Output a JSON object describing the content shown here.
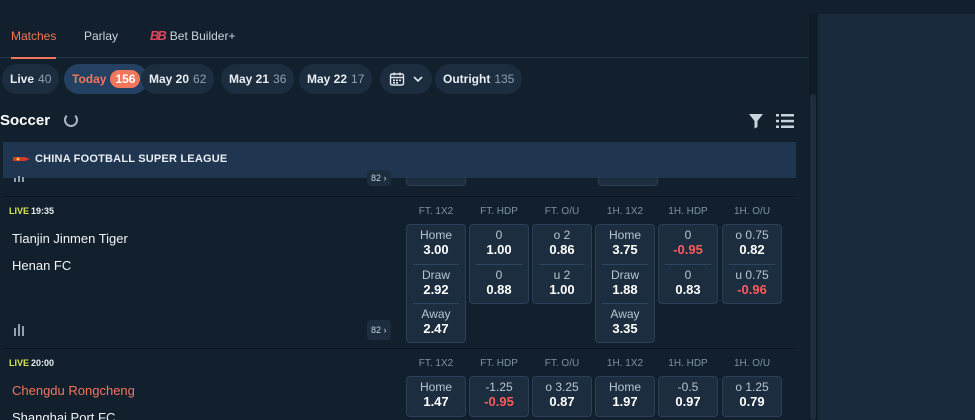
{
  "tabs": [
    {
      "label": "Matches",
      "active": true
    },
    {
      "label": "Parlay",
      "active": false
    },
    {
      "label": "Bet Builder+",
      "active": false
    }
  ],
  "date_filters": [
    {
      "label": "Live",
      "count": "40",
      "active": false
    },
    {
      "label": "Today",
      "count": "156",
      "active": true
    },
    {
      "label": "May 20",
      "count": "62",
      "active": false
    },
    {
      "label": "May 21",
      "count": "36",
      "active": false
    },
    {
      "label": "May 22",
      "count": "17",
      "active": false
    },
    {
      "label": "Outright",
      "count": "135",
      "active": false
    }
  ],
  "sport_title": "Soccer",
  "league_name": "CHINA FOOTBALL SUPER LEAGUE",
  "prev_more_count": "82",
  "matches": [
    {
      "live": "LIVE",
      "time": "19:35",
      "home": "Tianjin Jinmen Tiger",
      "away": "Henan FC",
      "more_count": "82",
      "headers": [
        "FT. 1X2",
        "FT. HDP",
        "FT. O/U",
        "1H. 1X2",
        "1H. HDP",
        "1H. O/U"
      ],
      "odds": [
        [
          {
            "label": "Home",
            "value": "3.00"
          },
          {
            "label": "Draw",
            "value": "2.92"
          },
          {
            "label": "Away",
            "value": "2.47"
          }
        ],
        [
          {
            "label": "0",
            "value": "1.00"
          },
          {
            "label": "0",
            "value": "0.88"
          }
        ],
        [
          {
            "label": "o 2",
            "value": "0.86"
          },
          {
            "label": "u 2",
            "value": "1.00"
          }
        ],
        [
          {
            "label": "Home",
            "value": "3.75"
          },
          {
            "label": "Draw",
            "value": "1.88"
          },
          {
            "label": "Away",
            "value": "3.35"
          }
        ],
        [
          {
            "label": "0",
            "value": "-0.95"
          },
          {
            "label": "0",
            "value": "0.83"
          }
        ],
        [
          {
            "label": "o 0.75",
            "value": "0.82"
          },
          {
            "label": "u 0.75",
            "value": "-0.96"
          }
        ]
      ]
    },
    {
      "live": "LIVE",
      "time": "20:00",
      "home": "Chengdu Rongcheng",
      "away": "Shanghai Port FC",
      "headers": [
        "FT. 1X2",
        "FT. HDP",
        "FT. O/U",
        "1H. 1X2",
        "1H. HDP",
        "1H. O/U"
      ],
      "odds": [
        [
          {
            "label": "Home",
            "value": "1.47"
          }
        ],
        [
          {
            "label": "-1.25",
            "value": "-0.95"
          }
        ],
        [
          {
            "label": "o 3.25",
            "value": "0.87"
          }
        ],
        [
          {
            "label": "Home",
            "value": "1.97"
          }
        ],
        [
          {
            "label": "-0.5",
            "value": "0.97"
          }
        ],
        [
          {
            "label": "o 1.25",
            "value": "0.79"
          }
        ]
      ]
    }
  ],
  "colors": {
    "accent": "#f2765b",
    "live": "#d7e84b",
    "negative": "#ff5a5a"
  }
}
